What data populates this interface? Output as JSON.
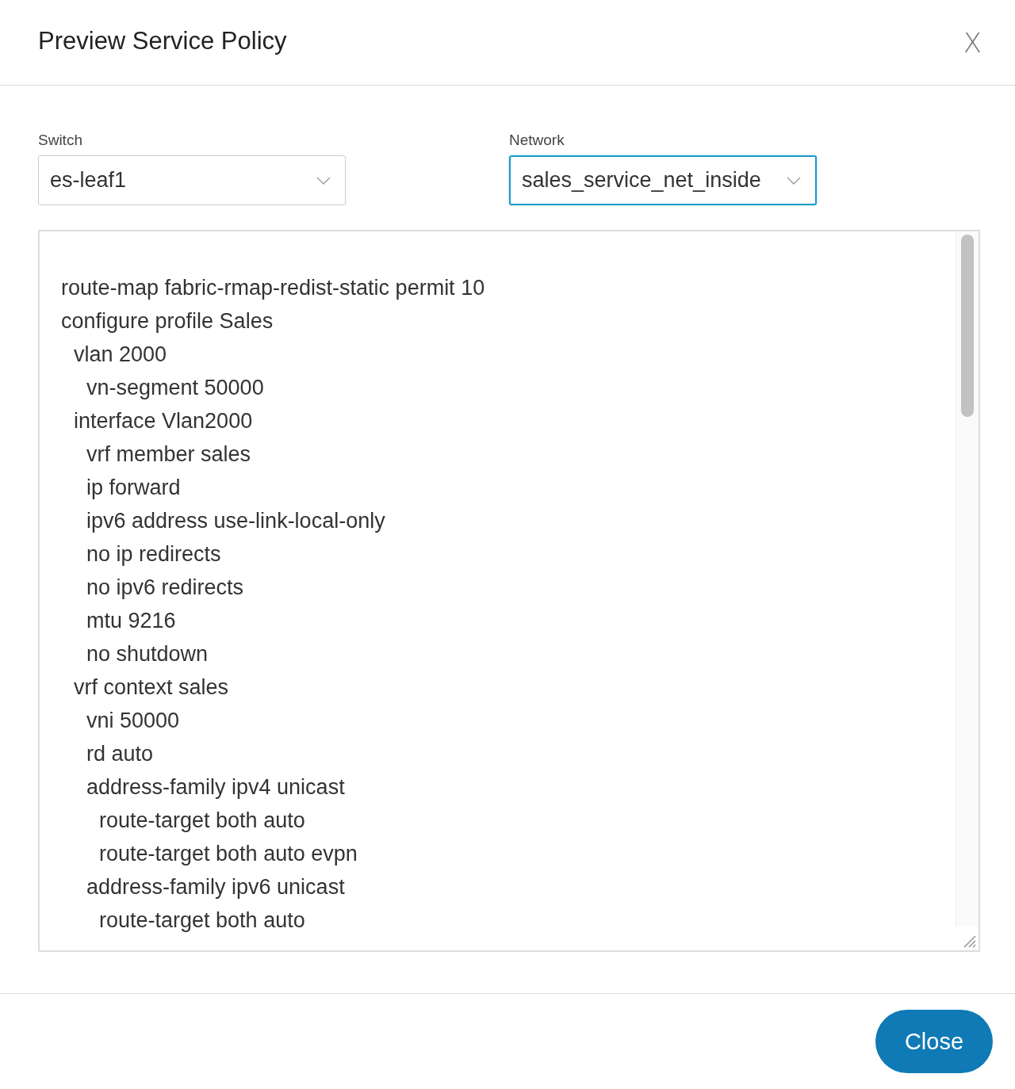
{
  "dialog": {
    "title": "Preview Service Policy",
    "close_icon": "X"
  },
  "fields": [
    {
      "label": "Switch",
      "value": "es-leaf1",
      "focused": false
    },
    {
      "label": "Network",
      "value": "sales_service_net_inside",
      "focused": true
    }
  ],
  "config_lines": [
    {
      "text": "route-map fabric-rmap-redist-static permit 10"
    },
    {
      "text": "configure profile Sales",
      "children": [
        {
          "text": "vlan 2000",
          "children": [
            {
              "text": "vn-segment 50000"
            }
          ]
        },
        {
          "text": "interface Vlan2000",
          "children": [
            {
              "text": "vrf member sales"
            },
            {
              "text": "ip forward"
            },
            {
              "text": "ipv6 address use-link-local-only"
            },
            {
              "text": "no ip redirects"
            },
            {
              "text": "no ipv6 redirects"
            },
            {
              "text": "mtu 9216"
            },
            {
              "text": "no shutdown"
            }
          ]
        },
        {
          "text": "vrf context sales",
          "children": [
            {
              "text": "vni 50000"
            },
            {
              "text": "rd auto"
            },
            {
              "text": "address-family ipv4 unicast",
              "children": [
                {
                  "text": "route-target both auto"
                },
                {
                  "text": "route-target both auto evpn"
                }
              ]
            },
            {
              "text": "address-family ipv6 unicast",
              "children": [
                {
                  "text": "route-target both auto"
                }
              ]
            }
          ]
        }
      ]
    }
  ],
  "footer": {
    "button": "Close"
  }
}
